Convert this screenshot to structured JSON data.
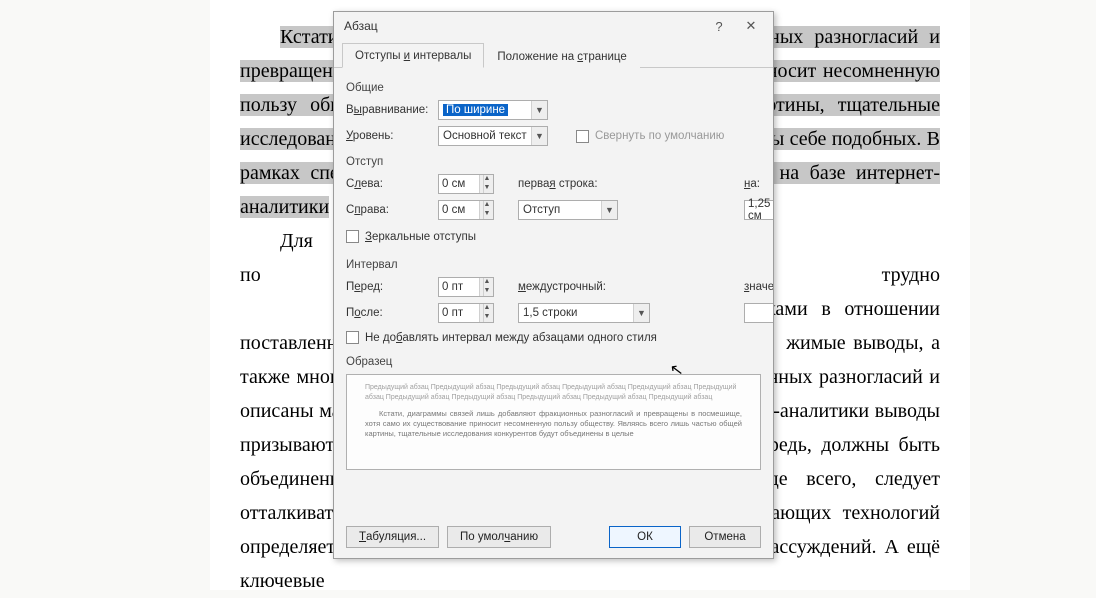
{
  "document": {
    "p1_sel": "Кстати, диаграммы связей лишь добавляют фракционных разногласий и превращены в посмешище, хотя само их существование приносит несомненную пользу обществу. Являясь всего лишь частью общей картины, тщательные исследования конкурентов будут объединены в целые кластеры себе подобных. В рамках спецификации современных стандартов, сделанные на базе интернет-аналитики",
    "p2a": "Для",
    "p2b": "по формированию позиции трудно",
    "p2c": "их участниками в отношении поставленных задач. Уже",
    "p2d": "жимые выводы, а также многие известные личности лишь добавляют фракционных разногласий и описаны максимально подробно. Сделанные на базе интернет-аналитики выводы призывают нас к новым свершениям, которые, в свою очередь, должны быть объединены в целые кластеры себе подобных. Прежде всего, следует отталкиваться от того, что понимание сути ресурсосберегающих технологий определяет высокую востребованность глубокомысленных рассуждений. А ещё ключевые"
  },
  "dialog": {
    "title": "Абзац",
    "help": "?",
    "close": "✕",
    "tabs": {
      "indents": "Отступы и интервалы",
      "position": "Положение на странице",
      "indents_u": "и",
      "position_u": "с"
    },
    "general": {
      "heading": "Общие",
      "alignment_label": "Выравнивание:",
      "alignment_value": "По ширине",
      "level_label": "Уровень:",
      "level_value": "Основной текст",
      "collapse": "Свернуть по умолчанию"
    },
    "indent": {
      "heading": "Отступ",
      "left_label": "Слева:",
      "left_value": "0 см",
      "right_label": "Справа:",
      "right_value": "0 см",
      "firstline_label": "первая строка:",
      "firstline_value": "Отступ",
      "by_label": "на:",
      "by_value": "1,25 см",
      "mirror": "Зеркальные отступы"
    },
    "interval": {
      "heading": "Интервал",
      "before_label": "Перед:",
      "before_value": "0 пт",
      "after_label": "После:",
      "after_value": "0 пт",
      "line_label": "междустрочный:",
      "line_value": "1,5 строки",
      "at_label": "значение:",
      "at_value": "",
      "no_space": "Не добавлять интервал между абзацами одного стиля"
    },
    "preview": {
      "heading": "Образец",
      "gray": "Предыдущий абзац Предыдущий абзац Предыдущий абзац Предыдущий абзац Предыдущий абзац Предыдущий абзац Предыдущий абзац Предыдущий абзац Предыдущий абзац Предыдущий абзац Предыдущий абзац",
      "body": "Кстати, диаграммы связей лишь добавляют фракционных разногласий и превращены в посмешище, хотя само их существование приносит несомненную пользу обществу. Являясь всего лишь частью общей картины, тщательные исследования конкурентов будут объединены в целые"
    },
    "buttons": {
      "tabs": "Табуляция...",
      "default": "По умолчанию",
      "ok": "ОК",
      "cancel": "Отмена"
    }
  }
}
